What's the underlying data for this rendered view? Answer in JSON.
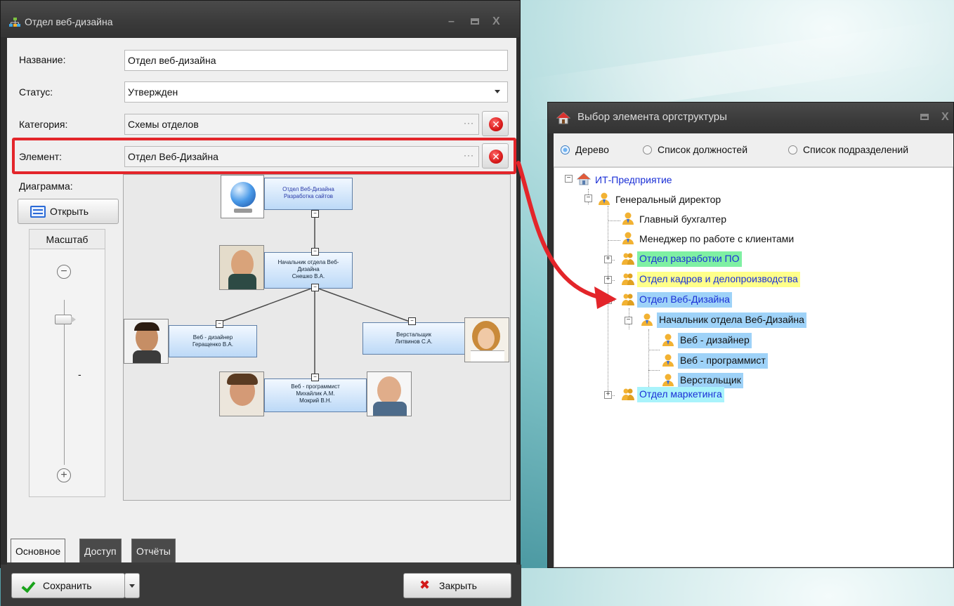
{
  "left_window": {
    "title": "Отдел веб-дизайна",
    "fields": {
      "name_label": "Название:",
      "name_value": "Отдел веб-дизайна",
      "status_label": "Статус:",
      "status_value": "Утвержден",
      "category_label": "Категория:",
      "category_value": "Схемы отделов",
      "element_label": "Элемент:",
      "element_value": "Отдел Веб-Дизайна",
      "ellipsis": "···"
    },
    "diagram_label": "Диаграмма:",
    "open_button": "Открыть",
    "scale": {
      "label": "Масштаб",
      "zoom_out": "⊖",
      "zoom_in": "⊕",
      "value_marker": "-"
    },
    "diagram": {
      "nodes": [
        {
          "line1": "Отдел Веб-Дизайна",
          "line2": "Разработка сайтов",
          "line3": ""
        },
        {
          "line1": "Начальник отдела Веб-",
          "line2": "Дизайна",
          "line3": "Снешко В.А."
        },
        {
          "line1": "Веб - дизайнер",
          "line2": "Геращенко В.А.",
          "line3": ""
        },
        {
          "line1": "Верстальщик",
          "line2": "Литвинов С.А.",
          "line3": ""
        },
        {
          "line1": "Веб - программист",
          "line2": "Михайлик А.М.",
          "line3": "Мокрий В.Н."
        }
      ],
      "collapse_symbol": "−"
    },
    "tabs": [
      "Основное",
      "Доступ",
      "Отчёты"
    ],
    "save_button": "Сохранить",
    "close_button": "Закрыть"
  },
  "right_window": {
    "title": "Выбор элемента оргструктуры",
    "radios": [
      "Дерево",
      "Список должностей",
      "Список подразделений"
    ],
    "selected_radio": "Дерево",
    "tree": [
      {
        "label": "ИТ-Предприятие"
      },
      {
        "label": "Генеральный директор"
      },
      {
        "label": "Главный бухгалтер"
      },
      {
        "label": "Менеджер по работе с клиентами"
      },
      {
        "label": "Отдел разработки ПО"
      },
      {
        "label": "Отдел кадров и делопроизводства"
      },
      {
        "label": "Отдел Веб-Дизайна"
      },
      {
        "label": "Начальник отдела Веб-Дизайна"
      },
      {
        "label": "Веб - дизайнер"
      },
      {
        "label": "Веб - программист"
      },
      {
        "label": "Верстальщик"
      },
      {
        "label": "Отдел маркетинга"
      }
    ]
  },
  "colors": {
    "highlight_red": "#e3252a",
    "tree_selection_blue": "#9ed2f8",
    "tree_green": "#7ff0a3",
    "tree_yellow": "#ffff8a",
    "tree_cyan": "#a9f3fb"
  }
}
